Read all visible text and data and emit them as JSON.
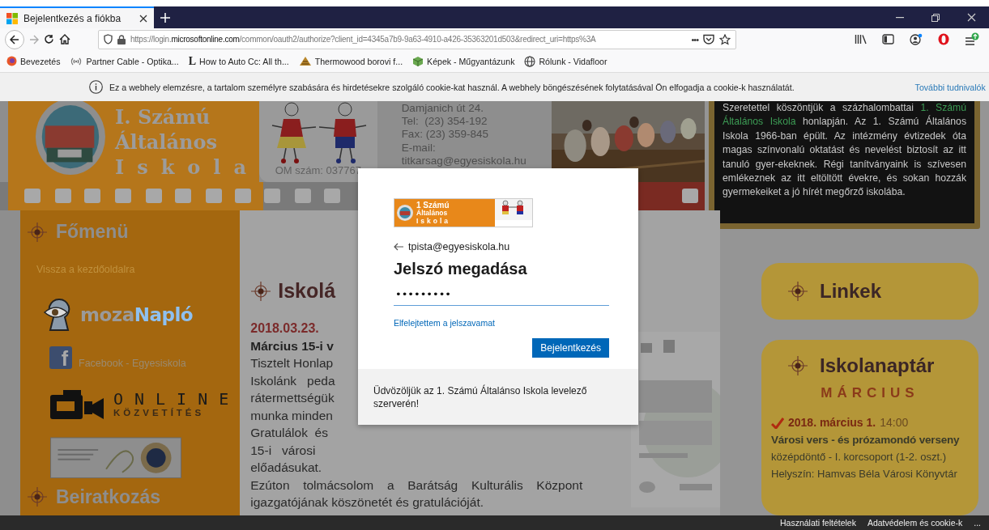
{
  "browser": {
    "tabs": [
      {
        "title": "Bejelentkezés a fiókba",
        "selected": true
      }
    ],
    "url": "https://login.**microsoftonline.com**/common/oauth2/authorize?client_id=4345a7b9-9a63-4910-a426-35363201d503&redirect_uri=https%3A",
    "url_more": "•••",
    "bookmarks": [
      {
        "label": "Bevezetés",
        "kind": "firefox"
      },
      {
        "label": "Partner Cable - Optika...",
        "kind": "broadcast"
      },
      {
        "label": "How to Auto Cc: All th...",
        "kind": "letter",
        "glyph": "L"
      },
      {
        "label": "Thermowood borovi f...",
        "kind": "cone"
      },
      {
        "label": "Képek - Műgyantázunk",
        "kind": "cube"
      },
      {
        "label": "Rólunk - Vidafloor",
        "kind": "globe"
      }
    ]
  },
  "cookie_notice": {
    "text": "Ez a webhely elemzésre, a tartalom személyre szabására és hirdetésekre szolgáló cookie-kat használ. A webhely böngészésének folytatásával Ön elfogadja a cookie-k használatát.",
    "link": "További tudnivalók"
  },
  "site": {
    "header": {
      "title_lines": [
        "I. Számú",
        "Általános",
        "Iskola"
      ],
      "om": "OM szám: 037767",
      "contact": [
        "Damjanich út 24.",
        "Tel:  (23) 354-192",
        "Fax: (23) 359-845",
        "E-mail:",
        "titkarsag@egyesiskola.hu"
      ],
      "welcome": "Szeretettel köszöntjük a százhalombattai **1. Számú Általános Iskola** honlapján. Az 1. Számú Általános Iskola 1966-ban épült. Az intézmény évtizedek óta magas színvonalú oktatást és nevelést biztosít az itt tanuló gyer-ekeknek. Régi tanítványaink is szívesen emlékeznek az itt eltöltött évekre, és sokan hozzák gyermekeiket a jó hírét megőrző iskolába."
    },
    "sidebar": {
      "heading": "Főmenü",
      "home_link": "Vissza a kezdőoldalra",
      "diary_logo": [
        "moza",
        "Napló"
      ],
      "facebook_glyph": "f",
      "facebook": "Facebook - Egyesiskola",
      "online": [
        "ONLINE",
        "KÖZVETÍTÉS"
      ],
      "next_heading": "Beiratkozás"
    },
    "article": {
      "heading": "Iskolá",
      "date": "2018.03.23.",
      "title": "Március 15-i v",
      "cut_lines": [
        "Tisztelt Honlap",
        "Iskolánk   peda",
        "rátermettségük",
        "munka minden",
        "Gratulálok  és",
        "15-i   városi"
      ],
      "lines": [
        "előadásukat.",
        "Ezúton tolmácsolom a Barátság Kulturális Központ",
        "igazgatójának köszönetét és gratulációját."
      ]
    },
    "links_card": {
      "heading": "Linkek"
    },
    "calendar": {
      "heading": "Iskolanaptár",
      "month": "MÁRCIUS",
      "events": [
        {
          "date": "2018. március 1.",
          "time": "14:00",
          "title": "Városi vers - és prózamondó verseny",
          "detail": "középdöntő - I. korcsoport (1-2. oszt.)",
          "place": "Helyszín: Hamvas Béla Városi Könyvtár"
        }
      ]
    }
  },
  "dialog": {
    "logo_text": [
      "1 Számú",
      "Általános",
      "Iskola"
    ],
    "account": "tpista@egyesiskola.hu",
    "heading": "Jelszó megadása",
    "password": "•••••••••",
    "forgot_link": "Elfelejtettem a jelszavamat",
    "submit": "Bejelentkezés",
    "footer": "Üdvözöljük az 1. Számú Általánso Iskola levelező szerverén!"
  },
  "footer": {
    "links": [
      "Használati feltételek",
      "Adatvédelem és cookie-k"
    ],
    "more": "..."
  }
}
